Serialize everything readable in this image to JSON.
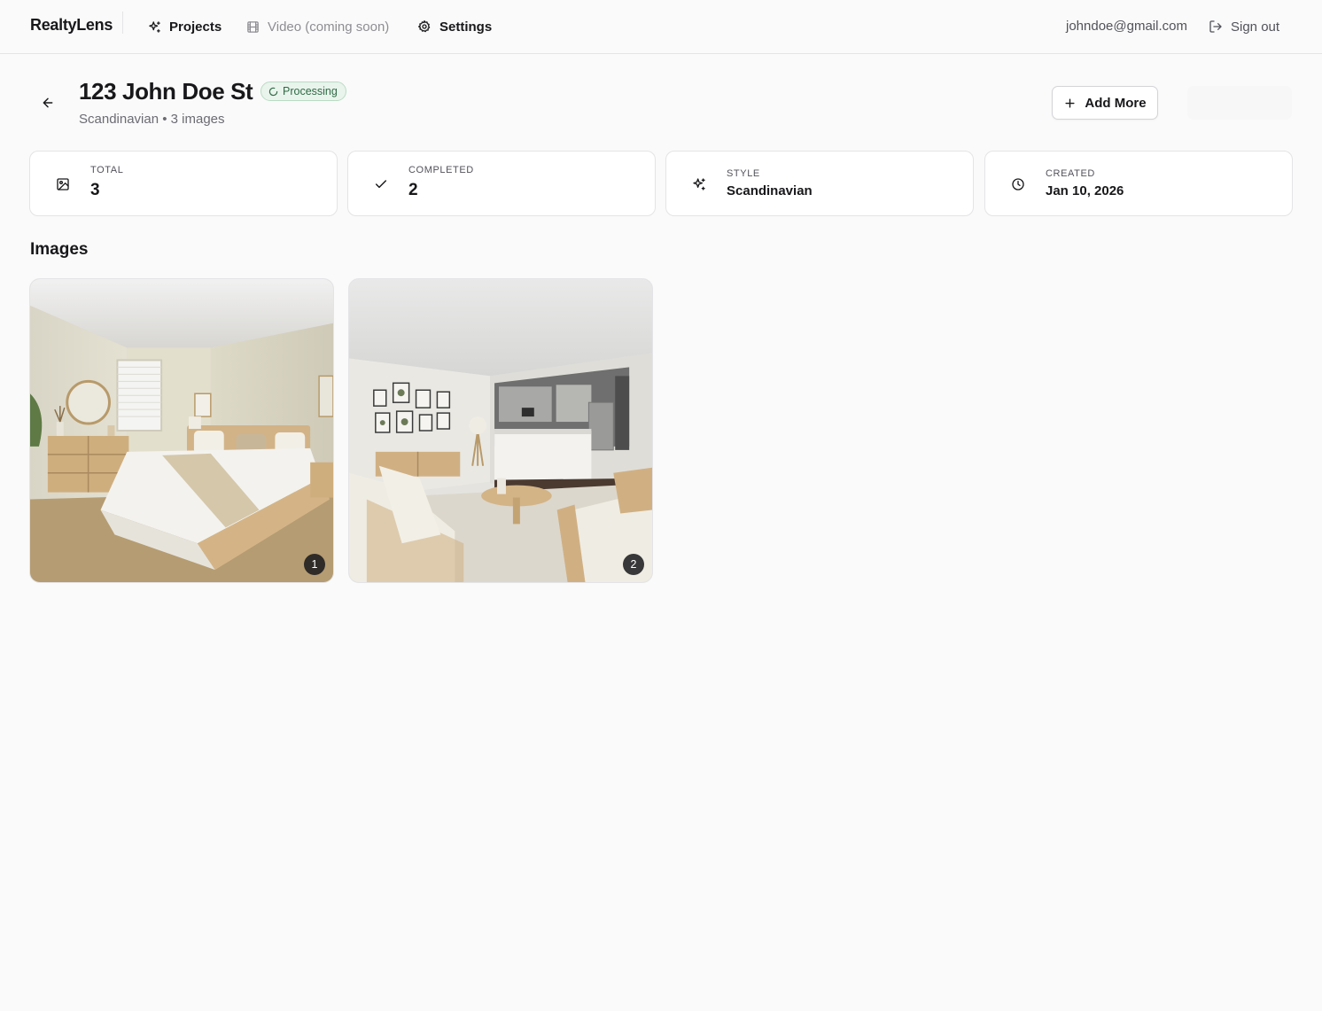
{
  "app": {
    "brand": "RealtyLens"
  },
  "nav": {
    "projects": "Projects",
    "video": "Video (coming soon)",
    "settings": "Settings"
  },
  "user": {
    "email": "johndoe@gmail.com",
    "signout": "Sign out"
  },
  "project": {
    "title": "123 John Doe St",
    "status": "Processing",
    "subtitle": "Scandinavian • 3 images",
    "add_more": "Add More"
  },
  "stats": {
    "total_label": "Total",
    "total_value": "3",
    "completed_label": "Completed",
    "completed_value": "2",
    "style_label": "Style",
    "style_value": "Scandinavian",
    "created_label": "Created",
    "created_value": "Jan 10, 2026"
  },
  "images_section": {
    "title": "Images",
    "items": [
      {
        "index": "1",
        "scene": "bedroom"
      },
      {
        "index": "2",
        "scene": "living-room"
      }
    ]
  },
  "colors": {
    "background": "#fafafa",
    "badge_bg": "#e9f4ec",
    "badge_text": "#2f6b45",
    "border": "#e4e4e7"
  }
}
